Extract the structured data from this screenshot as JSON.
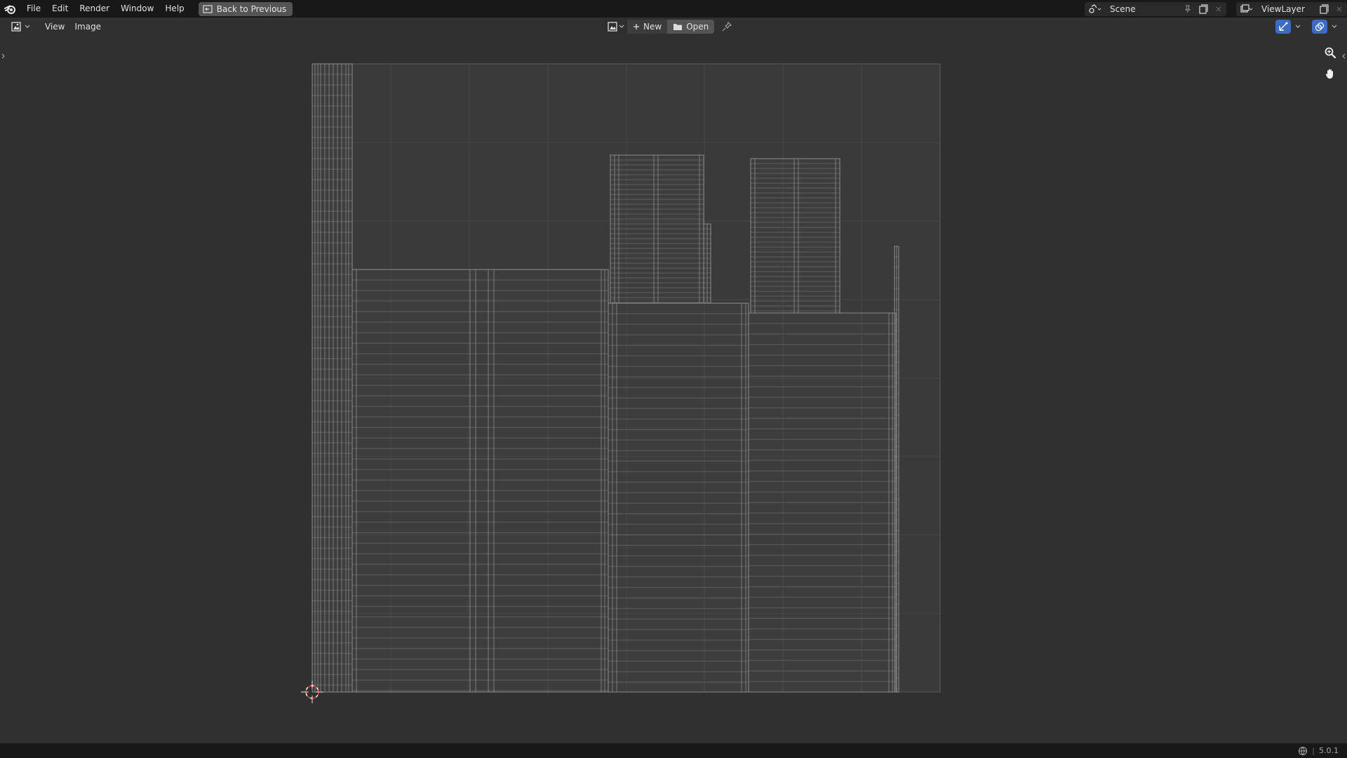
{
  "topbar": {
    "menus": [
      "File",
      "Edit",
      "Render",
      "Window",
      "Help"
    ],
    "back_button": "Back to Previous",
    "scene": {
      "label": "Scene",
      "icon": "scene-icon"
    },
    "view_layer": {
      "label": "ViewLayer",
      "icon": "render-layers-icon"
    }
  },
  "editor_header": {
    "editor_type_icon": "image-editor-icon",
    "menus": [
      "View",
      "Image"
    ],
    "new_label": "New",
    "open_label": "Open"
  },
  "statusbar": {
    "version": "5.0.1"
  },
  "colors": {
    "topbar_bg": "#181818",
    "editor_bg": "#303030",
    "uv_background": "#3c3c3c",
    "uv_wire": "#8c8c8c",
    "cursor_red": "#e0403a",
    "active_blue": "#3d6bc0"
  }
}
